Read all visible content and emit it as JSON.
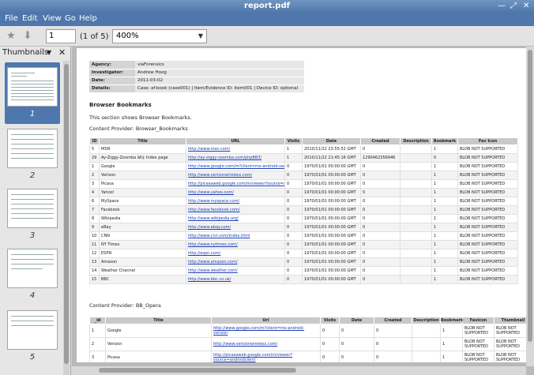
{
  "window": {
    "title": "report.pdf"
  },
  "menu": [
    "File",
    "Edit",
    "View",
    "Go",
    "Help"
  ],
  "toolbar": {
    "page_value": "1",
    "page_of": "(1 of 5)",
    "zoom_value": "400%"
  },
  "sidebar": {
    "header_label": "Thumbnails",
    "pages": [
      "1",
      "2",
      "3",
      "4",
      "5"
    ],
    "selected_page": "1"
  },
  "document": {
    "meta": [
      {
        "key": "Agency:",
        "value": "viaForensics"
      },
      {
        "key": "Investigator:",
        "value": "Andrew Hoog"
      },
      {
        "key": "Date:",
        "value": "2011-03-02"
      },
      {
        "key": "Details:",
        "value": "Case: af-book (case001) | Item/Evidence ID: item001 | Device ID: optional"
      }
    ],
    "section_title": "Browser Bookmarks",
    "section_desc": "This section shows Browser Bookmarks.",
    "provider1": "Content Provider: Browser_Bookmarks",
    "bookmarks_headers": [
      "ID",
      "Title",
      "URL",
      "Visits",
      "Date",
      "Created",
      "Description",
      "Bookmark",
      "Fav Icon"
    ],
    "bookmarks_rows": [
      [
        "5",
        "MSN",
        "http://www.msn.com/",
        "1",
        "2010/11/22 23:55:52 GMT",
        "0",
        "",
        "1",
        "BLOB NOT SUPPORTED"
      ],
      [
        "29",
        "Ay-Ziggy-Zoomba â€¢ Index page",
        "http://ay-ziggy-zoomba.com/phpBB3/",
        "1",
        "2010/11/22 21:45:16 GMT",
        "1290462356946",
        "",
        "0",
        "BLOB NOT SUPPORTED"
      ],
      [
        "1",
        "Google",
        "http://www.google.com/m?client=ms-android-verizon",
        "0",
        "1970/01/01 00:00:00 GMT",
        "0",
        "",
        "1",
        "BLOB NOT SUPPORTED"
      ],
      [
        "2",
        "Verizon",
        "http://www.verizonwireless.com/",
        "0",
        "1970/01/01 00:00:00 GMT",
        "0",
        "",
        "1",
        "BLOB NOT SUPPORTED"
      ],
      [
        "3",
        "Picasa",
        "http://picasaweb.google.com/m/viewer?source=androidclient",
        "0",
        "1970/01/01 00:00:00 GMT",
        "0",
        "",
        "1",
        "BLOB NOT SUPPORTED"
      ],
      [
        "4",
        "Yahoo!",
        "http://www.yahoo.com/",
        "0",
        "1970/01/01 00:00:00 GMT",
        "0",
        "",
        "1",
        "BLOB NOT SUPPORTED"
      ],
      [
        "6",
        "MySpace",
        "http://www.myspace.com/",
        "0",
        "1970/01/01 00:00:00 GMT",
        "0",
        "",
        "1",
        "BLOB NOT SUPPORTED"
      ],
      [
        "7",
        "Facebook",
        "http://www.facebook.com/",
        "0",
        "1970/01/01 00:00:00 GMT",
        "0",
        "",
        "1",
        "BLOB NOT SUPPORTED"
      ],
      [
        "8",
        "Wikipedia",
        "http://www.wikipedia.org/",
        "0",
        "1970/01/01 00:00:00 GMT",
        "0",
        "",
        "1",
        "BLOB NOT SUPPORTED"
      ],
      [
        "9",
        "eBay",
        "http://www.ebay.com/",
        "0",
        "1970/01/01 00:00:00 GMT",
        "0",
        "",
        "1",
        "BLOB NOT SUPPORTED"
      ],
      [
        "10",
        "CNN",
        "http://www.cnn.com/index.html",
        "0",
        "1970/01/01 00:00:00 GMT",
        "0",
        "",
        "1",
        "BLOB NOT SUPPORTED"
      ],
      [
        "11",
        "NY Times",
        "http://www.nytimes.com/",
        "0",
        "1970/01/01 00:00:00 GMT",
        "0",
        "",
        "1",
        "BLOB NOT SUPPORTED"
      ],
      [
        "12",
        "ESPN",
        "http://espn.com/",
        "0",
        "1970/01/01 00:00:00 GMT",
        "0",
        "",
        "1",
        "BLOB NOT SUPPORTED"
      ],
      [
        "13",
        "Amazon",
        "http://www.amazon.com/",
        "0",
        "1970/01/01 00:00:00 GMT",
        "0",
        "",
        "1",
        "BLOB NOT SUPPORTED"
      ],
      [
        "14",
        "Weather Channel",
        "http://www.weather.com/",
        "0",
        "1970/01/01 00:00:00 GMT",
        "0",
        "",
        "1",
        "BLOB NOT SUPPORTED"
      ],
      [
        "15",
        "BBC",
        "http://www.bbc.co.uk/",
        "0",
        "1970/01/01 00:00:00 GMT",
        "0",
        "",
        "1",
        "BLOB NOT SUPPORTED"
      ]
    ],
    "provider2": "Content Provider: BB_Opera",
    "opera_headers": [
      "_id",
      "Title",
      "Url",
      "Visits",
      "Date",
      "Created",
      "Description",
      "Bookmark",
      "Favicon",
      "Thumbnail"
    ],
    "opera_rows": [
      [
        "1",
        "Google",
        "http://www.google.com/m?client=ms-android-verizon",
        "0",
        "0",
        "0",
        "",
        "1",
        "BLOB NOT SUPPORTED",
        "BLOB NOT SUPPORTED"
      ],
      [
        "2",
        "Verizon",
        "http://www.verizonwireless.com/",
        "0",
        "0",
        "0",
        "",
        "1",
        "BLOB NOT SUPPORTED",
        "BLOB NOT SUPPORTED"
      ],
      [
        "3",
        "Picasa",
        "http://picasaweb.google.com/m/viewer?source=androidclient",
        "0",
        "0",
        "0",
        "",
        "1",
        "BLOB NOT SUPPORTED",
        "BLOB NOT SUPPORTED"
      ]
    ]
  }
}
